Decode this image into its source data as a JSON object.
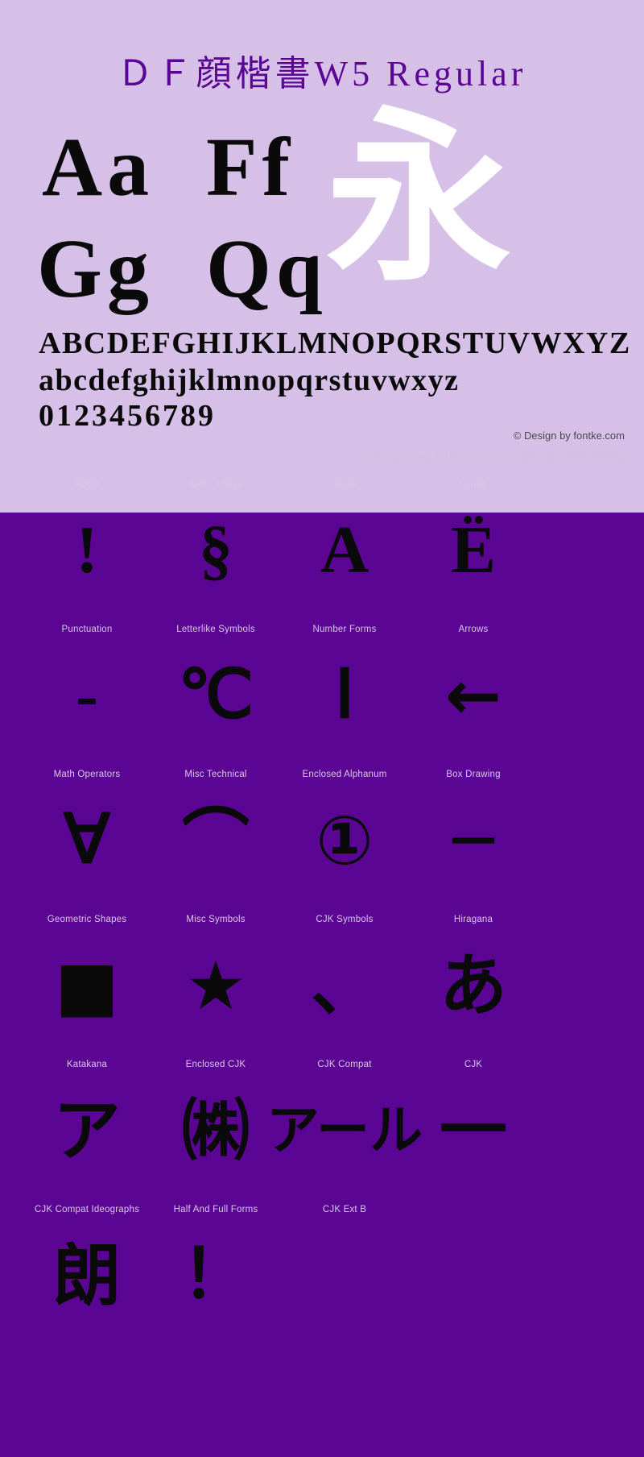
{
  "specimen": {
    "title": "ＤＦ顔楷書W5 Regular",
    "samples": [
      {
        "name": "pair-aa",
        "text": "Aa"
      },
      {
        "name": "pair-ff",
        "text": "Ff"
      },
      {
        "name": "pair-gg",
        "text": "Gg"
      },
      {
        "name": "pair-qq",
        "text": "Qq"
      }
    ],
    "cjk_sample": "永",
    "alphabet_upper": "ABCDEFGHIJKLMNOPQRSTUVWXYZ",
    "alphabet_lower": "abcdefghijklmnopqrstuvwxyz",
    "digits": "0123456789",
    "design_credit": "© Design by fontke.com",
    "font_source": "Font Source: http://www.fontke.com/font/53124062/",
    "colors": {
      "panel_background": "#d6c0e8",
      "title_color": "#5b0594",
      "glyph_color": "#0a0a0a",
      "cjk_sample_color": "#ffffff"
    }
  },
  "grid": {
    "background": "#5b0594",
    "label_color": "#d8c8e6",
    "rows": [
      {
        "cells": [
          {
            "label": "ASCII",
            "glyph": "!"
          },
          {
            "label": "Latin 1 Sup",
            "glyph": "§"
          },
          {
            "label": "Greek",
            "glyph": "Α"
          },
          {
            "label": "Cyrillic",
            "glyph": "Ё"
          }
        ]
      },
      {
        "cells": [
          {
            "label": "Punctuation",
            "glyph": "‐"
          },
          {
            "label": "Letterlike Symbols",
            "glyph": "℃"
          },
          {
            "label": "Number Forms",
            "glyph": "Ⅰ"
          },
          {
            "label": "Arrows",
            "glyph": "←"
          }
        ]
      },
      {
        "cells": [
          {
            "label": "Math Operators",
            "glyph": "∀"
          },
          {
            "label": "Misc Technical",
            "glyph": "⌒"
          },
          {
            "label": "Enclosed Alphanum",
            "glyph": "①"
          },
          {
            "label": "Box Drawing",
            "glyph": "─"
          }
        ]
      },
      {
        "cells": [
          {
            "label": "Geometric Shapes",
            "glyph": "■"
          },
          {
            "label": "Misc Symbols",
            "glyph": "★"
          },
          {
            "label": "CJK Symbols",
            "glyph": "、"
          },
          {
            "label": "Hiragana",
            "glyph": "あ"
          }
        ]
      },
      {
        "cells": [
          {
            "label": "Katakana",
            "glyph": "ア"
          },
          {
            "label": "Enclosed CJK",
            "glyph": "㈱"
          },
          {
            "label": "CJK Compat",
            "glyph": "アール"
          },
          {
            "label": "CJK",
            "glyph": "一"
          }
        ]
      },
      {
        "cells": [
          {
            "label": "CJK Compat Ideographs",
            "glyph": "朗"
          },
          {
            "label": "Half And Full Forms",
            "glyph": "！"
          },
          {
            "label": "CJK Ext B",
            "glyph": ""
          },
          {
            "label": "",
            "glyph": ""
          }
        ]
      }
    ]
  }
}
